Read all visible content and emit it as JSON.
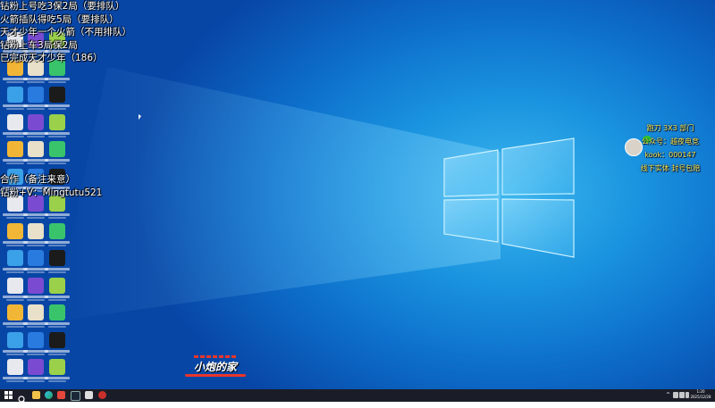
{
  "stream_overlay_left": {
    "lines": [
      "钻粉上号吃3保2局（要排队）",
      "火箭插队得吃5局（要排队）",
      "天才少年一个火箭（不用排队）",
      "钻粉上车3局保2局",
      "已完成天才少年（186）"
    ],
    "contact_lines": [
      "合作（备注来意）",
      "钻粉+V：Mingtutu521"
    ]
  },
  "stream_overlay_right": {
    "lines": [
      "跑刀 3X3 部门",
      "公众号：越夜电竞",
      "kook：000147",
      "线下实体 封号包赔"
    ]
  },
  "watermark": {
    "text": "小炮的家"
  },
  "colors": {
    "overlay_right_text": "#f4e542",
    "watermark_accent": "#e8362a",
    "taskbar_bg": "#1a1d27",
    "desktop_center": "#3db7ee",
    "desktop_edge": "#0846a6"
  },
  "taskbar": {
    "start_icon": "windows-start-icon",
    "search_icon": "search-icon",
    "pinned_apps": [
      "file-explorer-icon",
      "edge-icon",
      "app-red-icon",
      "steam-icon",
      "app-white-icon",
      "app-red-circle-icon"
    ],
    "tray_icons": [
      "chevron-up-icon",
      "network-icon",
      "volume-icon",
      "ime-icon"
    ],
    "clock_time": "1:20",
    "clock_date": "2025/12/28"
  },
  "desktop_icons": [
    "recycle-bin-icon",
    "app-icon",
    "app-icon",
    "app-icon",
    "app-icon",
    "app-icon",
    "edge-icon",
    "app-icon",
    "wps-icon",
    "nvidia-icon",
    "folder-icon",
    "app-icon",
    "app-icon",
    "app-icon",
    "app-icon",
    "qq-icon",
    "document-icon",
    "app-icon",
    "steam-icon",
    "app-64-icon",
    "tiktok-icon",
    "app-icon",
    "trash-icon",
    "document-icon",
    "app-icon",
    "razer-icon",
    "document-icon",
    "app-icon",
    "app-icon",
    "app-icon",
    "app-icon",
    "app-icon",
    "app-icon",
    "app-icon",
    "app-icon",
    "app-icon",
    "app-icon",
    "app-icon",
    "app-icon"
  ]
}
